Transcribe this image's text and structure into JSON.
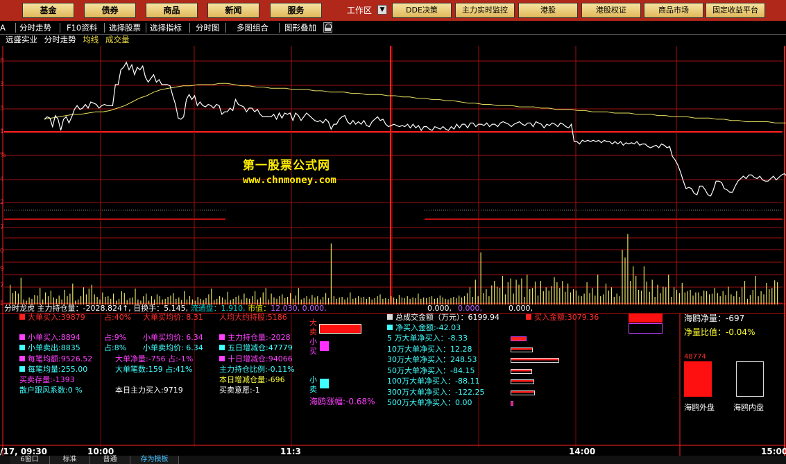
{
  "menu": {
    "jijin": "基金",
    "zhaiquan": "债券",
    "shangpin": "商品",
    "xinwen": "新闻",
    "fuwu": "服务",
    "workarea": "工作区",
    "dde": "DDE决策",
    "zhuli": "主力实时监控",
    "ganggu": "港股",
    "gangguquanzheng": "港股权证",
    "shangpinshichang": "商品市场",
    "guding": "固定收益平台"
  },
  "toolbar": {
    "left_cut": "A",
    "fenshi": "分时走势",
    "f10": "F10资料",
    "xuanzegupiao": "选择股票",
    "xuanzezhibiao": "选择指标",
    "fenshitu": "分时图",
    "duotu": "多图组合",
    "tuxing": "图形叠加"
  },
  "stockline": {
    "name": "远盛实业",
    "mode": "分时走势",
    "ma": "均线",
    "vol": "成交量"
  },
  "watermark": {
    "line1": "第一股票公式网",
    "line2": "www.chnmoney.com"
  },
  "axis": {
    "left_ticks": [
      "8",
      "3",
      "3",
      "1",
      "%",
      "4",
      "2",
      "7",
      "0",
      "9",
      "7",
      "5"
    ],
    "time_labels": [
      "/17, 09:30",
      "10:00",
      "11:3",
      "14:00",
      "15:00"
    ]
  },
  "chart_data": {
    "type": "line",
    "price_series": {
      "values": [
        0.44,
        0.46,
        0.45,
        0.38,
        0.47,
        0.44,
        0.35,
        0.44,
        0.46,
        0.41,
        0.46,
        0.52,
        0.55,
        0.52,
        0.53,
        0.56,
        0.53,
        0.58,
        0.57,
        0.56,
        0.53,
        0.55,
        0.56,
        0.55,
        0.55,
        0.55,
        0.72,
        0.72,
        0.84,
        0.86,
        0.9,
        0.84,
        0.88,
        0.8,
        0.86,
        0.84,
        0.87,
        0.78,
        0.74,
        0.77,
        0.8,
        0.74,
        0.76,
        0.72,
        0.72,
        0.72,
        0.71,
        0.63,
        0.56,
        0.45,
        0.44,
        0.46,
        0.6,
        0.64,
        0.6,
        0.63,
        0.55,
        0.58,
        0.55,
        0.54,
        0.56,
        0.55,
        0.53,
        0.56,
        0.55,
        0.48,
        0.5,
        0.5,
        0.53,
        0.51,
        0.6,
        0.56,
        0.55,
        0.54,
        0.5,
        0.53,
        0.53,
        0.5,
        0.52,
        0.48,
        0.46,
        0.46,
        0.46,
        0.46,
        0.48,
        0.44,
        0.49,
        0.45,
        0.49,
        0.48,
        0.49,
        0.43,
        0.49,
        0.47,
        0.43,
        0.46,
        0.49,
        0.47,
        0.45,
        0.43,
        0.42,
        0.43,
        0.41,
        0.44,
        0.42,
        0.36,
        0.4,
        0.4,
        0.44,
        0.46,
        0.47,
        0.42,
        0.4,
        0.43,
        0.4,
        0.42,
        0.4,
        0.43,
        0.39,
        0.38,
        0.42,
        0.44,
        0.46,
        0.43,
        0.44,
        0.4,
        0.38,
        0.39,
        0.4,
        0.39,
        0.38,
        0.39,
        0.38,
        0.4,
        0.37,
        0.4,
        0.37,
        0.39,
        0.35,
        0.38,
        0.38,
        0.36,
        0.35,
        0.38,
        0.37,
        0.36,
        0.38,
        0.36,
        0.35,
        0.38,
        0.36,
        0.4,
        0.37,
        0.4,
        0.4,
        0.37,
        0.41,
        0.41,
        0.38,
        0.4,
        0.4,
        0.39,
        0.41,
        0.38,
        0.4,
        0.4,
        0.38,
        0.41,
        0.42,
        0.41,
        0.4,
        0.38,
        0.4,
        0.41,
        0.42,
        0.4,
        0.39,
        0.41,
        0.41,
        0.38,
        0.42,
        0.41,
        0.4,
        0.37,
        0.4,
        0.39,
        0.41,
        0.4,
        0.38,
        0.41,
        0.4,
        0.38,
        0.37,
        0.4,
        0.26,
        0.26,
        0.24,
        0.27,
        0.26,
        0.27,
        0.26,
        0.27,
        0.26,
        0.27,
        0.25,
        0.27,
        0.26,
        0.26,
        0.24,
        0.26,
        0.24,
        0.26,
        0.23,
        0.25,
        0.24,
        0.25,
        0.24,
        0.26,
        0.23,
        0.24,
        0.24,
        0.22,
        0.21,
        0.22,
        0.23,
        0.21,
        0.24,
        0.23,
        0.21,
        0.22,
        0.14,
        0.11,
        0.07,
        0.01,
        -0.06,
        -0.12,
        -0.11,
        -0.12,
        -0.16,
        -0.17,
        -0.1,
        -0.1,
        -0.13,
        -0.17,
        -0.18,
        -0.13,
        -0.06,
        -0.06,
        -0.07,
        -0.12,
        -0.13,
        -0.15,
        -0.15,
        -0.1,
        -0.06,
        -0.04,
        -0.02,
        -0.04,
        -0.01,
        -0.01,
        -0.03,
        -0.04,
        -0.02,
        -0.05,
        -0.06,
        -0.06,
        -0.04,
        -0.02,
        -0.05,
        -0.03,
        -0.01,
        0.0,
        -0.02,
        -0.02,
        0.01,
        0.02,
        0.03,
        0.07,
        0.06,
        0.1,
        0.1,
        0.14
      ],
      "color": "#ffffff"
    },
    "avg_series": {
      "values": [
        0.44,
        0.45,
        0.46,
        0.47,
        0.48,
        0.48,
        0.49,
        0.5,
        0.5,
        0.51,
        0.53,
        0.55,
        0.58,
        0.61,
        0.63,
        0.66,
        0.68,
        0.69,
        0.7,
        0.71,
        0.71,
        0.72,
        0.72,
        0.72,
        0.73,
        0.73,
        0.72,
        0.71,
        0.71,
        0.7,
        0.7,
        0.69,
        0.69,
        0.69,
        0.68,
        0.68,
        0.68,
        0.67,
        0.67,
        0.66,
        0.66,
        0.66,
        0.65,
        0.65,
        0.64,
        0.64,
        0.64,
        0.63,
        0.63,
        0.62,
        0.62,
        0.61,
        0.61,
        0.6,
        0.6,
        0.59,
        0.59,
        0.58,
        0.57,
        0.57,
        0.56,
        0.56,
        0.55,
        0.55,
        0.55,
        0.54,
        0.54,
        0.54,
        0.53,
        0.53,
        0.52,
        0.52,
        0.52,
        0.51,
        0.51,
        0.5,
        0.5,
        0.5,
        0.49,
        0.49,
        0.49,
        0.48,
        0.48,
        0.48,
        0.47,
        0.47,
        0.46,
        0.46,
        0.46,
        0.45,
        0.45,
        0.45,
        0.44,
        0.44,
        0.43,
        0.43,
        0.42,
        0.42,
        0.42,
        0.42,
        0.41,
        0.41,
        0.41,
        0.4,
        0.4,
        0.4
      ],
      "color": "#e8e060"
    },
    "volume_bars": [
      31,
      18,
      21,
      17,
      42,
      8,
      6,
      11,
      9,
      15,
      14,
      26,
      8,
      19,
      13,
      22,
      11,
      9,
      14,
      8,
      23,
      13,
      17,
      33,
      6,
      8,
      13,
      27,
      16,
      25,
      31,
      16,
      12,
      8,
      19,
      12,
      13,
      9,
      17,
      6,
      9,
      21,
      18,
      7,
      10,
      11,
      25,
      8,
      6,
      13,
      17,
      6,
      13,
      8,
      16,
      13,
      8,
      9,
      12,
      14,
      18,
      9,
      11,
      7,
      21,
      8,
      13,
      8,
      6,
      12,
      9,
      7,
      10,
      16,
      25,
      7,
      9,
      13,
      11,
      8,
      20,
      7,
      9,
      12,
      14,
      8,
      17,
      10,
      9,
      13,
      21,
      8,
      11,
      19,
      26,
      8,
      17,
      11,
      9,
      13,
      16,
      10,
      12,
      18,
      9,
      14,
      26,
      8,
      10,
      13,
      9,
      15,
      11,
      13,
      8,
      12,
      18,
      10,
      96,
      13,
      9,
      11,
      12,
      8,
      11,
      19,
      9,
      10,
      13,
      11,
      12,
      9,
      12,
      8,
      10,
      13,
      16,
      9,
      10,
      9,
      13,
      11,
      9,
      15,
      11,
      10,
      13,
      9,
      11,
      10,
      17,
      9,
      11,
      10,
      12,
      13,
      9,
      10,
      14,
      11,
      9,
      8,
      10,
      12,
      10,
      14,
      11,
      13,
      18,
      27,
      12,
      39,
      13,
      82,
      18,
      24,
      13,
      30,
      37,
      28,
      26,
      45,
      16,
      35,
      41,
      17,
      39,
      31,
      41,
      12,
      47,
      24,
      26,
      36,
      14,
      37,
      21,
      27,
      22,
      29,
      43,
      35,
      26,
      37,
      20,
      33,
      19,
      24,
      22,
      14,
      13,
      17,
      35,
      18,
      26,
      14,
      47,
      13,
      16,
      33,
      22,
      27,
      12,
      17,
      13,
      86,
      74,
      111,
      37,
      60,
      45,
      23,
      22,
      60,
      36,
      20,
      39,
      12,
      31,
      18,
      28,
      27,
      47,
      12,
      27,
      23,
      18,
      34,
      19,
      21,
      23,
      14,
      19,
      19,
      13,
      22,
      21,
      16,
      17,
      26,
      18,
      13,
      21,
      15,
      28,
      16,
      13,
      21,
      12,
      27,
      37,
      9,
      15,
      23,
      45,
      13,
      21,
      16,
      34,
      24,
      26,
      38,
      35
    ],
    "xlim": [
      0,
      240
    ],
    "price_ylim": [
      -0.3,
      1.0
    ],
    "volume_ylim": [
      0,
      130
    ]
  },
  "info": {
    "header": "分时龙虎",
    "zhuli_chicang": "主力持仓量：",
    "zhuli_val": "-2028.824↑,",
    "rihuanshou": "日换手：",
    "rihuanshou_val": "5.145,",
    "liutongpan": "流通盘：",
    "liutongpan_val": "1.910,",
    "shizhi": "市值：",
    "shizhi_val": "12.030,",
    "z1": "0.000,",
    "z2": "0.000,",
    "z3": "0.000,",
    "z4": "0.000,"
  },
  "left_stats": [
    {
      "label": "大单买入:39879",
      "c2": "占:40%",
      "c3": "大单买均价: 8.31",
      "c4": "人均大约持股:5186"
    },
    {
      "label": "小单买入:8894",
      "c2": "占:9%",
      "c3": "小单买均价: 6.34",
      "c4": "主力持仓量:-2028"
    },
    {
      "label": "小单卖出:8835",
      "c2": "占:8%",
      "c3": "小单卖均价: 6.34",
      "c4": "五日增减仓:47779"
    },
    {
      "label": "每笔均额:9526.52",
      "c2": "",
      "c3": "大单净量:-756  占:-1%",
      "c4": "十日增减仓:94066"
    },
    {
      "label": "每笔均量:255.00",
      "c2": "",
      "c3": "大单笔数:159   占:41%",
      "c4": "主力持仓比例:-0.11%"
    },
    {
      "label": "买卖存量:-1393",
      "c2": "",
      "c3": "",
      "c4": "本日增减仓量:-696"
    },
    {
      "label": "散户跟风系数:0 %",
      "c2": "",
      "c3": "本日主力买入:9719",
      "c4": "买卖意愿:-1"
    }
  ],
  "mid": {
    "da": "大",
    "mai1": "卖",
    "xiao": "小",
    "mai2": "买",
    "xiao2": "小",
    "mai3": "卖",
    "haiou": "海鸥涨幅:-0.68%"
  },
  "flows": {
    "total": "总成交金额（万元）：6199.94",
    "buy": "买入金额:3079.36",
    "net": "净买入金额:-42.03",
    "rows": [
      "5 万大单净买入：-8.33",
      "10万大单净买入：12.28",
      "30万大单净买入：248.53",
      "50万大单净买入：-84.15",
      "100万大单净买入：-88.11",
      "300万大单净买入：-122.25",
      "500万大单净买入：0.00"
    ],
    "bars": [
      3,
      12,
      50,
      11,
      14,
      15,
      0
    ]
  },
  "right": {
    "net_vol": "海鸥净量：",
    "net_vol_val": "-697",
    "net_ratio": "净量比值：",
    "net_ratio_val": "-0.04%",
    "outer_val": "48774",
    "outer_label": "海鸥外盘",
    "inner_label": "海鸥内盘"
  },
  "bottom": {
    "tab1": "6窗口",
    "tab2": "标准",
    "tab3": "普通",
    "tab4": "存为模板"
  }
}
